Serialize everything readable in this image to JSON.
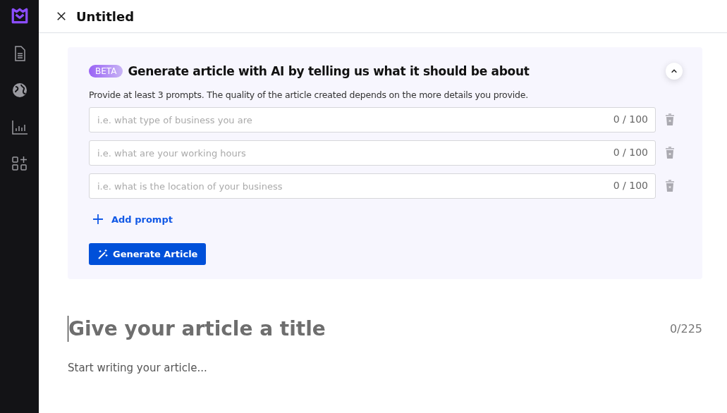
{
  "header": {
    "title": "Untitled"
  },
  "sidebar": {
    "items": [
      {
        "kind": "document"
      },
      {
        "kind": "globe"
      },
      {
        "kind": "chart"
      },
      {
        "kind": "apps"
      }
    ]
  },
  "ai_panel": {
    "badge": "BETA",
    "title": "Generate article with AI by telling us what it should be about",
    "expanded": true,
    "hint": "Provide at least 3 prompts. The quality of the article created depends on the more details you provide.",
    "prompts": [
      {
        "placeholder": "i.e. what type of business you are",
        "count": "0 / 100"
      },
      {
        "placeholder": "i.e. what are your working hours",
        "count": "0 / 100"
      },
      {
        "placeholder": "i.e. what is the location of your business",
        "count": "0 / 100"
      }
    ],
    "add_label": "Add prompt",
    "generate_label": "Generate Article"
  },
  "editor": {
    "title_placeholder": "Give your article a title",
    "title_count": "0/225",
    "body_placeholder": "Start writing your article..."
  }
}
